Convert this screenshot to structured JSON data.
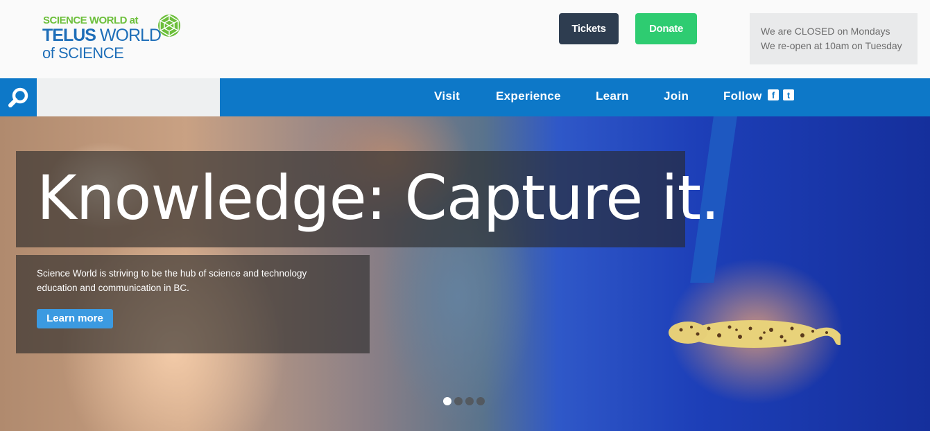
{
  "header": {
    "logo": {
      "line1": "SCIENCE WORLD at",
      "line2_bold": "TELUS",
      "line2_rest": "WORLD",
      "line3": "of SCIENCE"
    },
    "tickets_label": "Tickets",
    "donate_label": "Donate",
    "notice": {
      "line1": "We are CLOSED on Mondays",
      "line2": "We re-open at 10am on Tuesday"
    }
  },
  "nav": {
    "search_placeholder": "",
    "items": [
      {
        "label": "Visit"
      },
      {
        "label": "Experience"
      },
      {
        "label": "Learn"
      },
      {
        "label": "Join"
      },
      {
        "label": "Follow"
      }
    ],
    "social": {
      "facebook": "f",
      "twitter": "t"
    }
  },
  "hero": {
    "headline": "Knowledge: Capture it.",
    "description": "Science World is striving to be the hub of science and technology education and communication in BC.",
    "cta_label": "Learn more",
    "slides_count": 4,
    "active_slide": 1
  },
  "colors": {
    "nav_blue": "#0d78c8",
    "tickets_bg": "#2e3d50",
    "donate_bg": "#2ecc71",
    "logo_green": "#6cbf3b",
    "logo_blue": "#1e6eb8",
    "cta_blue": "#3b9ae1"
  },
  "icons": [
    "search-icon",
    "facebook-icon",
    "twitter-icon",
    "geodesic-globe-icon"
  ]
}
